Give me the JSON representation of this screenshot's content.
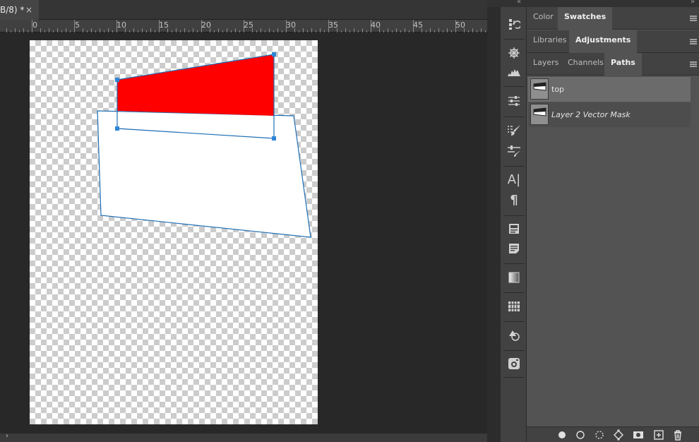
{
  "document": {
    "tab_title": "B/8) *",
    "close_glyph": "×"
  },
  "ruler": {
    "labels": [
      "0",
      "5",
      "10",
      "15",
      "20",
      "25",
      "30",
      "35",
      "40",
      "45",
      "50"
    ]
  },
  "panels": {
    "group1": {
      "tabs": [
        "Color",
        "Swatches"
      ],
      "active": "Swatches"
    },
    "group2": {
      "tabs": [
        "Libraries",
        "Adjustments"
      ],
      "active": "Adjustments"
    },
    "group3": {
      "tabs": [
        "Layers",
        "Channels",
        "Paths"
      ],
      "active": "Paths"
    },
    "paths": [
      {
        "name": "top",
        "selected": true,
        "italic": false
      },
      {
        "name": "Layer 2 Vector Mask",
        "selected": false,
        "italic": true
      }
    ]
  },
  "colors": {
    "shape_fill": "#ff0000",
    "path_stroke": "#1e6eb5",
    "anchor": "#2f86d6"
  },
  "icons": {
    "strip": [
      "history-icon",
      "navigator-icon",
      "histogram-icon",
      "adjustments-icon",
      "brush-presets-icon",
      "brush-settings-icon",
      "character-icon",
      "paragraph-icon",
      "properties-icon",
      "notes-icon",
      "gradient-icon",
      "timeline-icon",
      "clone-source-icon",
      "camera-icon"
    ],
    "footer": [
      "fill-path-icon",
      "stroke-path-icon",
      "load-selection-icon",
      "make-work-path-icon",
      "add-mask-icon",
      "new-path-icon",
      "delete-path-icon"
    ]
  }
}
